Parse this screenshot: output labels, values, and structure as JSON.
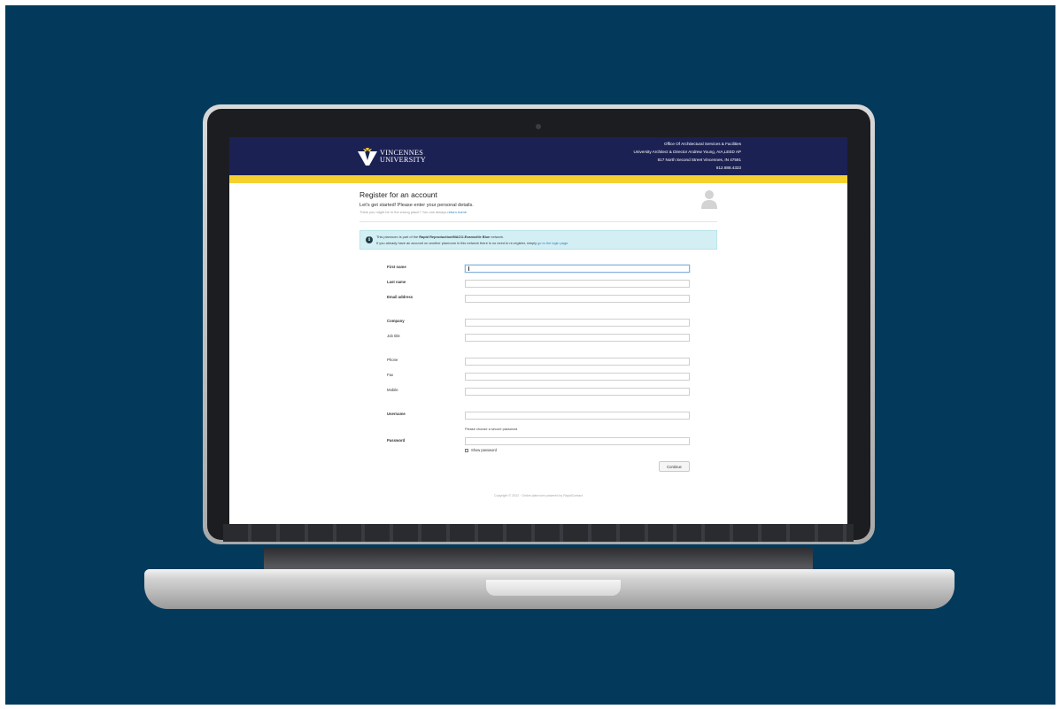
{
  "org": {
    "logo_line1": "VINCENNES",
    "logo_line2": "UNIVERSITY",
    "contact_lines": [
      "Office Of Architectural Services & Facilities",
      "University Architect & Director Andrew Young, AIA,LEED AP",
      "817 North Second Street Vincennes, IN 47591",
      "812.888.4323"
    ]
  },
  "page": {
    "title": "Register for an account",
    "subtitle": "Let's get started! Please enter your personal details.",
    "hint_prefix": "Think you might be in the wrong place? You can always ",
    "hint_link": "return home",
    "hint_suffix": "."
  },
  "notice": {
    "line1_prefix": "This planroom is part of the ",
    "line1_network": "Rapid Reproduction/MACO-Evansville Blue",
    "line1_suffix": " network.",
    "line2_prefix": "If you already have an account on another planroom in this network there is no need to re-register, simply ",
    "line2_link": "go to the login page",
    "line2_suffix": "."
  },
  "form": {
    "fields": [
      {
        "label": "First name",
        "value": ""
      },
      {
        "label": "Last name",
        "value": ""
      },
      {
        "label": "Email address",
        "value": ""
      },
      {
        "label": "Company",
        "value": ""
      },
      {
        "label": "Job title",
        "value": ""
      },
      {
        "label": "Phone",
        "value": ""
      },
      {
        "label": "Fax",
        "value": ""
      },
      {
        "label": "Mobile",
        "value": ""
      },
      {
        "label": "Username",
        "value": ""
      },
      {
        "label": "Password",
        "value": ""
      }
    ],
    "password_help": "Please choose a secure password",
    "show_password_label": "Show password",
    "show_password_checked": false,
    "continue_label": "Continue"
  },
  "footer": {
    "text": "Copyright © 2022 · Online planroom powered by RapidContact"
  },
  "colors": {
    "backdrop": "#033a5c",
    "header": "#1b2153",
    "accent": "#f5d130",
    "notice_bg": "#d4eff4",
    "link": "#3b82c4"
  }
}
